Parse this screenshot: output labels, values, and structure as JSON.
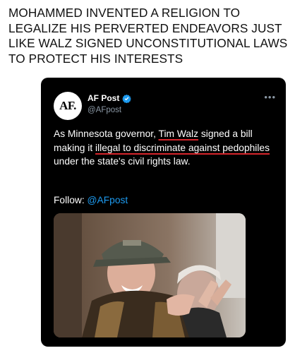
{
  "caption": "MOHAMMED INVENTED A RELIGION TO LEGALIZE HIS PERVERTED ENDEAVORS JUST LIKE WALZ SIGNED UNCONSTITUTIONAL LAWS TO PROTECT HIS INTERESTS",
  "tweet": {
    "avatar_text": "AF.",
    "display_name": "AF Post",
    "handle": "@AFpost",
    "more_icon": "more-dots-icon",
    "verified_icon": "verified-badge-icon",
    "verified_color": "#1d9bf0",
    "text": {
      "part1": "As Minnesota governor, ",
      "u1": "Tim Walz",
      "part2": " signed a bill making it ",
      "u2": "illegal to discriminate against pedophiles",
      "part3": " under the state's civil rights law."
    },
    "follow_label": "Follow: ",
    "follow_link": "@AFpost"
  },
  "colors": {
    "underline": "#d6262b",
    "card_bg": "#000000",
    "handle_gray": "#8b98a5"
  }
}
